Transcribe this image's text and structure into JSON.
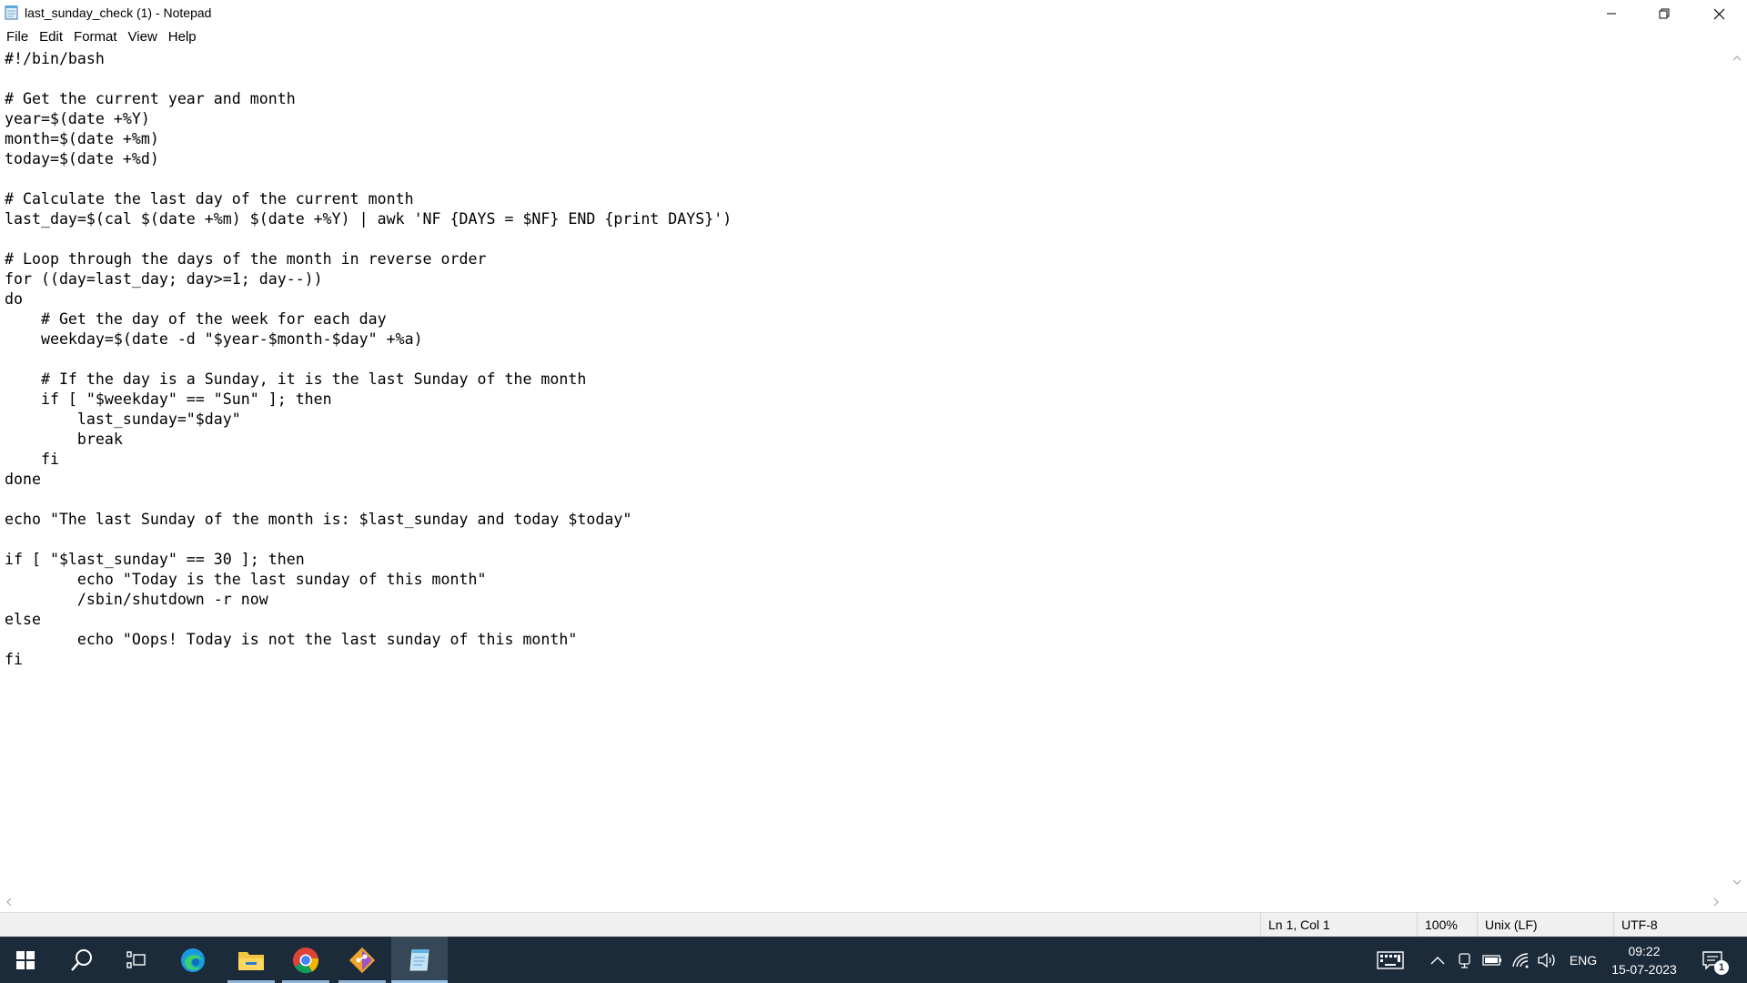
{
  "window": {
    "title": "last_sunday_check (1) - Notepad",
    "app_icon": "notepad-icon"
  },
  "menu": [
    {
      "label": "File"
    },
    {
      "label": "Edit"
    },
    {
      "label": "Format"
    },
    {
      "label": "View"
    },
    {
      "label": "Help"
    }
  ],
  "editor": {
    "content": "#!/bin/bash\n\n# Get the current year and month\nyear=$(date +%Y)\nmonth=$(date +%m)\ntoday=$(date +%d)\n\n# Calculate the last day of the current month\nlast_day=$(cal $(date +%m) $(date +%Y) | awk 'NF {DAYS = $NF} END {print DAYS}')\n\n# Loop through the days of the month in reverse order\nfor ((day=last_day; day>=1; day--))\ndo\n    # Get the day of the week for each day\n    weekday=$(date -d \"$year-$month-$day\" +%a)\n\n    # If the day is a Sunday, it is the last Sunday of the month\n    if [ \"$weekday\" == \"Sun\" ]; then\n        last_sunday=\"$day\"\n        break\n    fi\ndone\n\necho \"The last Sunday of the month is: $last_sunday and today $today\"\n\nif [ \"$last_sunday\" == 30 ]; then\n        echo \"Today is the last sunday of this month\"\n        /sbin/shutdown -r now\nelse\n        echo \"Oops! Today is not the last sunday of this month\"\nfi"
  },
  "statusbar": {
    "position": "Ln 1, Col 1",
    "zoom": "100%",
    "line_ending": "Unix (LF)",
    "encoding": "UTF-8"
  },
  "taskbar": {
    "apps": [
      {
        "name": "start",
        "icon": "windows-logo-icon"
      },
      {
        "name": "search",
        "icon": "search-icon"
      },
      {
        "name": "task-view",
        "icon": "task-view-icon"
      },
      {
        "name": "edge",
        "icon": "edge-icon"
      },
      {
        "name": "file-explorer",
        "icon": "folder-icon"
      },
      {
        "name": "chrome",
        "icon": "chrome-icon"
      },
      {
        "name": "git",
        "icon": "git-icon"
      },
      {
        "name": "notepad",
        "icon": "notepad-icon",
        "active": true
      }
    ],
    "tray": {
      "language": "ENG",
      "time": "09:22",
      "date": "15-07-2023",
      "notification_count": "1"
    }
  }
}
